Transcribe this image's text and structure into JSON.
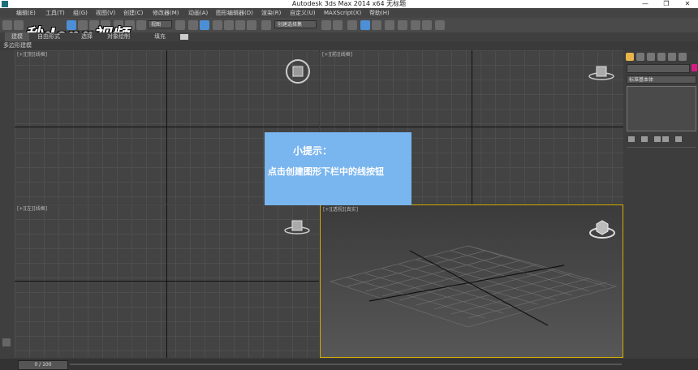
{
  "window": {
    "title": "Autodesk 3ds Max  2014 x64     无标题"
  },
  "menu": [
    "编辑(E)",
    "工具(T)",
    "组(G)",
    "视图(V)",
    "创建(C)",
    "修改器(M)",
    "动画(A)",
    "图形编辑器(D)",
    "渲染(R)",
    "自定义(U)",
    "MAXScript(X)",
    "帮助(H)"
  ],
  "toolbar": {
    "view_dropdown": "视图",
    "selection_set_placeholder": "创建选择集"
  },
  "ribbon": {
    "tabs": [
      "建模",
      "自由形式",
      "选择",
      "对象绘制",
      "填充"
    ],
    "sub_label": "多边形建模"
  },
  "viewports": {
    "top": "[+][顶][线框]",
    "front": "[+][前][线框]",
    "left": "[+][左][线框]",
    "perspective": "[+][透视][真实]"
  },
  "command_panel": {
    "dropdown": "标准基本体"
  },
  "timeline": {
    "frame": "0 / 100"
  },
  "watermark": "秒dong视频",
  "hint": {
    "title": "小提示：",
    "text": "点击创建图形下栏中的线按钮"
  }
}
